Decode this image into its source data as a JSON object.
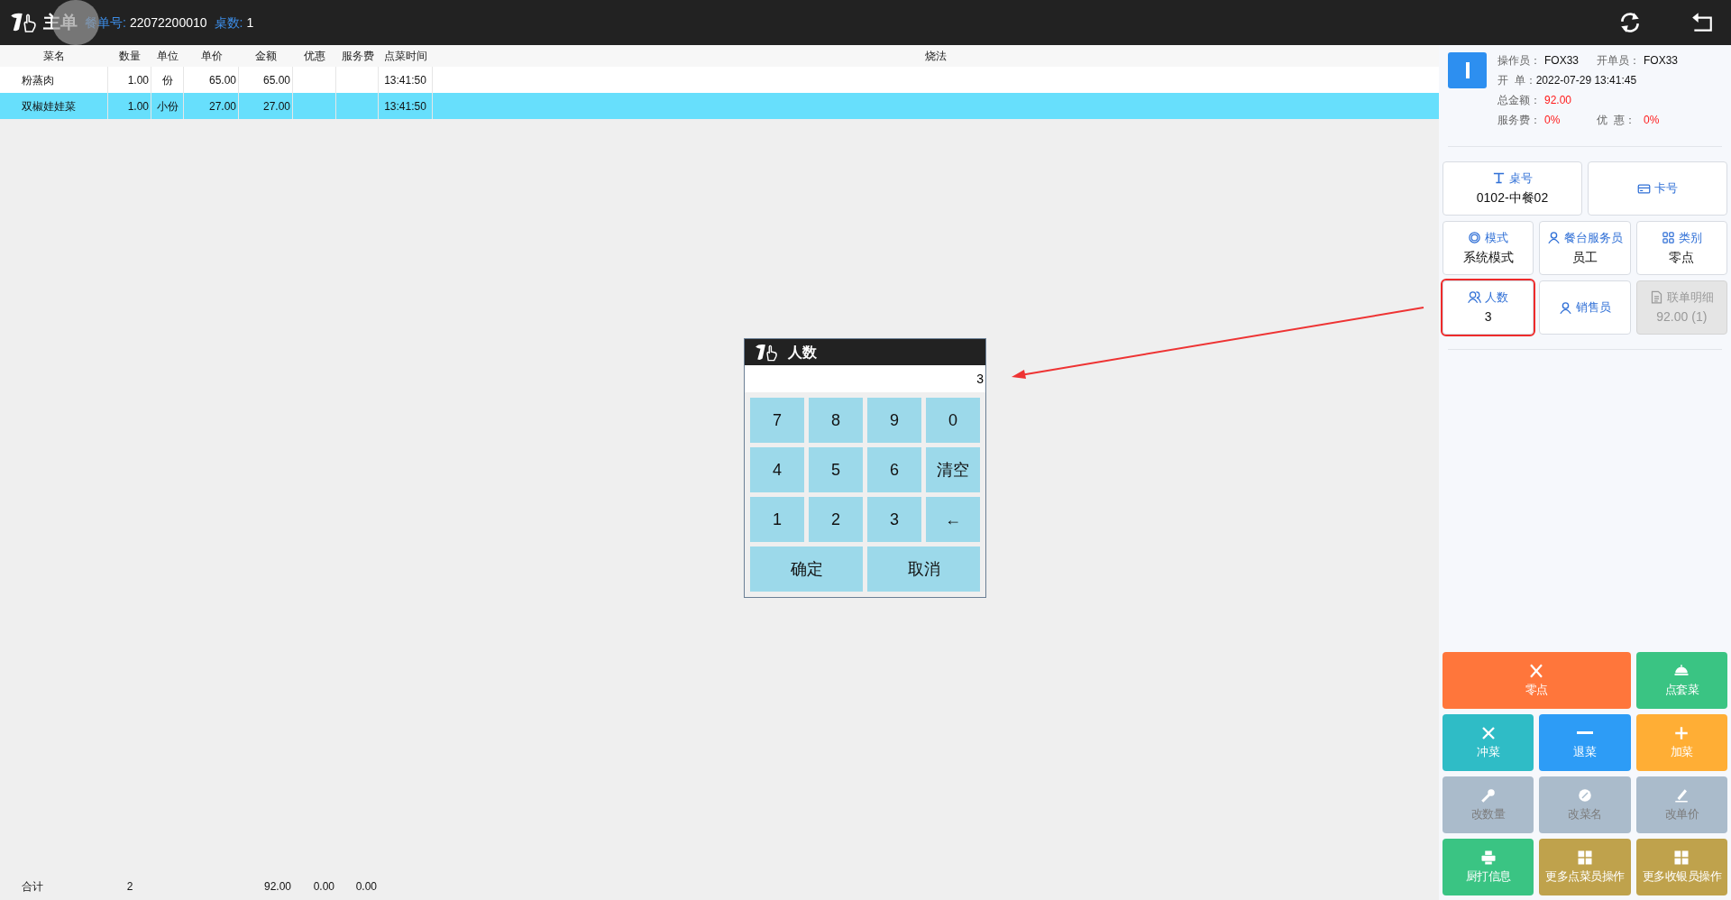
{
  "header": {
    "title": "主单",
    "order_label": "餐单号:",
    "order_no": "22072200010",
    "tables_label": "桌数:",
    "tables": "1"
  },
  "table": {
    "columns": [
      "菜名",
      "数量",
      "单位",
      "单价",
      "金额",
      "优惠",
      "服务费",
      "点菜时间",
      "烧法"
    ],
    "rows": [
      {
        "name": "粉蒸肉",
        "quantity": "1.00",
        "unit": "份",
        "price": "65.00",
        "amount": "65.00",
        "time": "13:41:50",
        "selected": false
      },
      {
        "name": "双椒娃娃菜",
        "quantity": "1.00",
        "unit": "小份",
        "price": "27.00",
        "amount": "27.00",
        "time": "13:41:50",
        "selected": true
      }
    ],
    "footer": {
      "name": "合计",
      "quantity": "2",
      "amount": "92.00",
      "discount": "0.00",
      "service": "0.00"
    }
  },
  "info": [
    [
      {
        "label": "操作员：",
        "value": "FOX33",
        "alert": false
      },
      {
        "label": "开单员：",
        "value": "FOX33",
        "alert": false
      }
    ],
    [
      {
        "label": "开  单：",
        "value": "2022-07-29 13:41:45",
        "alert": false
      }
    ],
    [
      {
        "label": "总金额：",
        "value": "92.00",
        "alert": true
      }
    ],
    [
      {
        "label": "服务费：",
        "value": "0%",
        "alert": true
      },
      {
        "label": "优  惠：",
        "value": "0%",
        "alert": true
      }
    ]
  ],
  "tiles": [
    {
      "kind": "table",
      "label": "桌号",
      "value": "0102-中餐02",
      "wide": true,
      "disabled": false,
      "highlighted": false
    },
    {
      "kind": "card",
      "label": "卡号",
      "wide": true,
      "disabled": false,
      "highlighted": false
    },
    {
      "kind": "ring",
      "label": "模式",
      "value": "系统模式",
      "wide": false,
      "disabled": false,
      "highlighted": false
    },
    {
      "kind": "person",
      "label": "餐台服务员",
      "value": "员工",
      "wide": false,
      "disabled": false,
      "highlighted": false
    },
    {
      "kind": "grid",
      "label": "类别",
      "value": "零点",
      "wide": false,
      "disabled": false,
      "highlighted": false
    },
    {
      "kind": "people",
      "label": "人数",
      "value": "3",
      "wide": false,
      "disabled": false,
      "highlighted": true
    },
    {
      "kind": "person",
      "label": "销售员",
      "wide": false,
      "disabled": false,
      "highlighted": false
    },
    {
      "kind": "doc",
      "label": "联单明细",
      "value": "92.00 (1)",
      "wide": false,
      "disabled": true,
      "highlighted": false
    }
  ],
  "actions": [
    {
      "kind": "fork",
      "label": "零点",
      "color": "#ff763b",
      "wide": true,
      "disabled": false
    },
    {
      "kind": "cloche",
      "label": "点套菜",
      "color": "#3ac483",
      "wide": false,
      "disabled": false
    },
    {
      "kind": "cross",
      "label": "冲菜",
      "color": "#2fbcc6",
      "wide": false,
      "disabled": false
    },
    {
      "kind": "minus",
      "label": "退菜",
      "color": "#2d9cf6",
      "wide": false,
      "disabled": false
    },
    {
      "kind": "plus",
      "label": "加菜",
      "color": "#ffae35",
      "wide": false,
      "disabled": false
    },
    {
      "kind": "wrench",
      "label": "改数量",
      "color": "#aabbcb",
      "wide": false,
      "disabled": true
    },
    {
      "kind": "compass",
      "label": "改菜名",
      "color": "#aabbcb",
      "wide": false,
      "disabled": true
    },
    {
      "kind": "pen",
      "label": "改单价",
      "color": "#aabbcb",
      "wide": false,
      "disabled": true
    },
    {
      "kind": "printer",
      "label": "厨打信息",
      "color": "#3ac483",
      "wide": false,
      "disabled": false
    },
    {
      "kind": "grid",
      "label": "更多点菜员操作",
      "color": "#bfa24c",
      "wide": false,
      "disabled": false
    },
    {
      "kind": "grid",
      "label": "更多收银员操作",
      "color": "#bfa24c",
      "wide": false,
      "disabled": false
    }
  ],
  "dialog": {
    "title": "人数",
    "value": "3",
    "keys": [
      "7",
      "8",
      "9",
      "0",
      "4",
      "5",
      "6",
      "清空",
      "1",
      "2",
      "3",
      "←"
    ],
    "buttons": [
      "确定",
      "取消"
    ]
  }
}
